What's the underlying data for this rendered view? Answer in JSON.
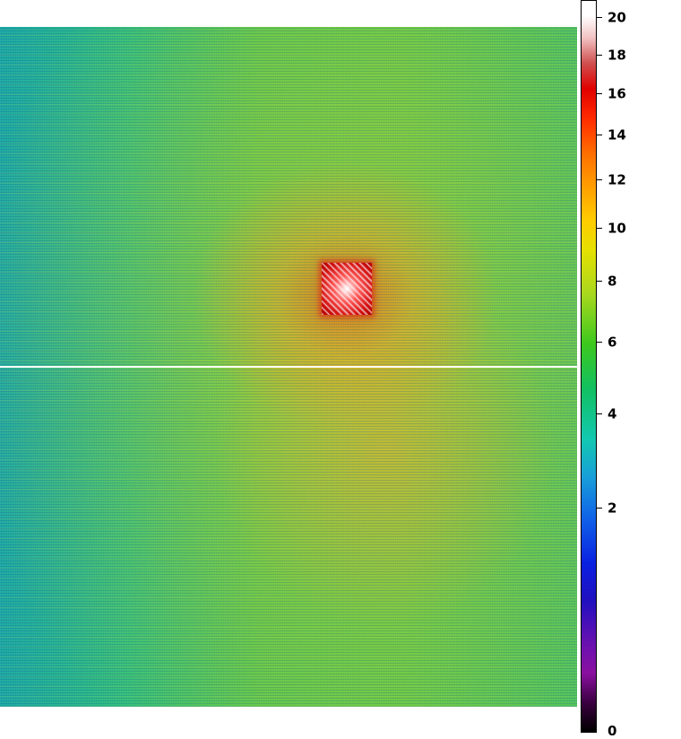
{
  "colorbar": {
    "ticks": [
      {
        "label": "20",
        "value": 20
      },
      {
        "label": "18",
        "value": 18
      },
      {
        "label": "16",
        "value": 16
      },
      {
        "label": "14",
        "value": 14
      },
      {
        "label": "12",
        "value": 12
      },
      {
        "label": "10",
        "value": 10
      },
      {
        "label": "8",
        "value": 8
      },
      {
        "label": "6",
        "value": 6
      },
      {
        "label": "4",
        "value": 4
      },
      {
        "label": "2",
        "value": 2
      },
      {
        "label": "0",
        "value": 0
      }
    ],
    "colors": {
      "top": "#ffffff",
      "high": "#e00000",
      "mid_high": "#ff9a00",
      "mid": "#3cc81e",
      "mid_low": "#12c8b0",
      "low": "#0a20e0",
      "bottom": "#000000"
    }
  },
  "image": {
    "type": "false-color intensity map"
  }
}
